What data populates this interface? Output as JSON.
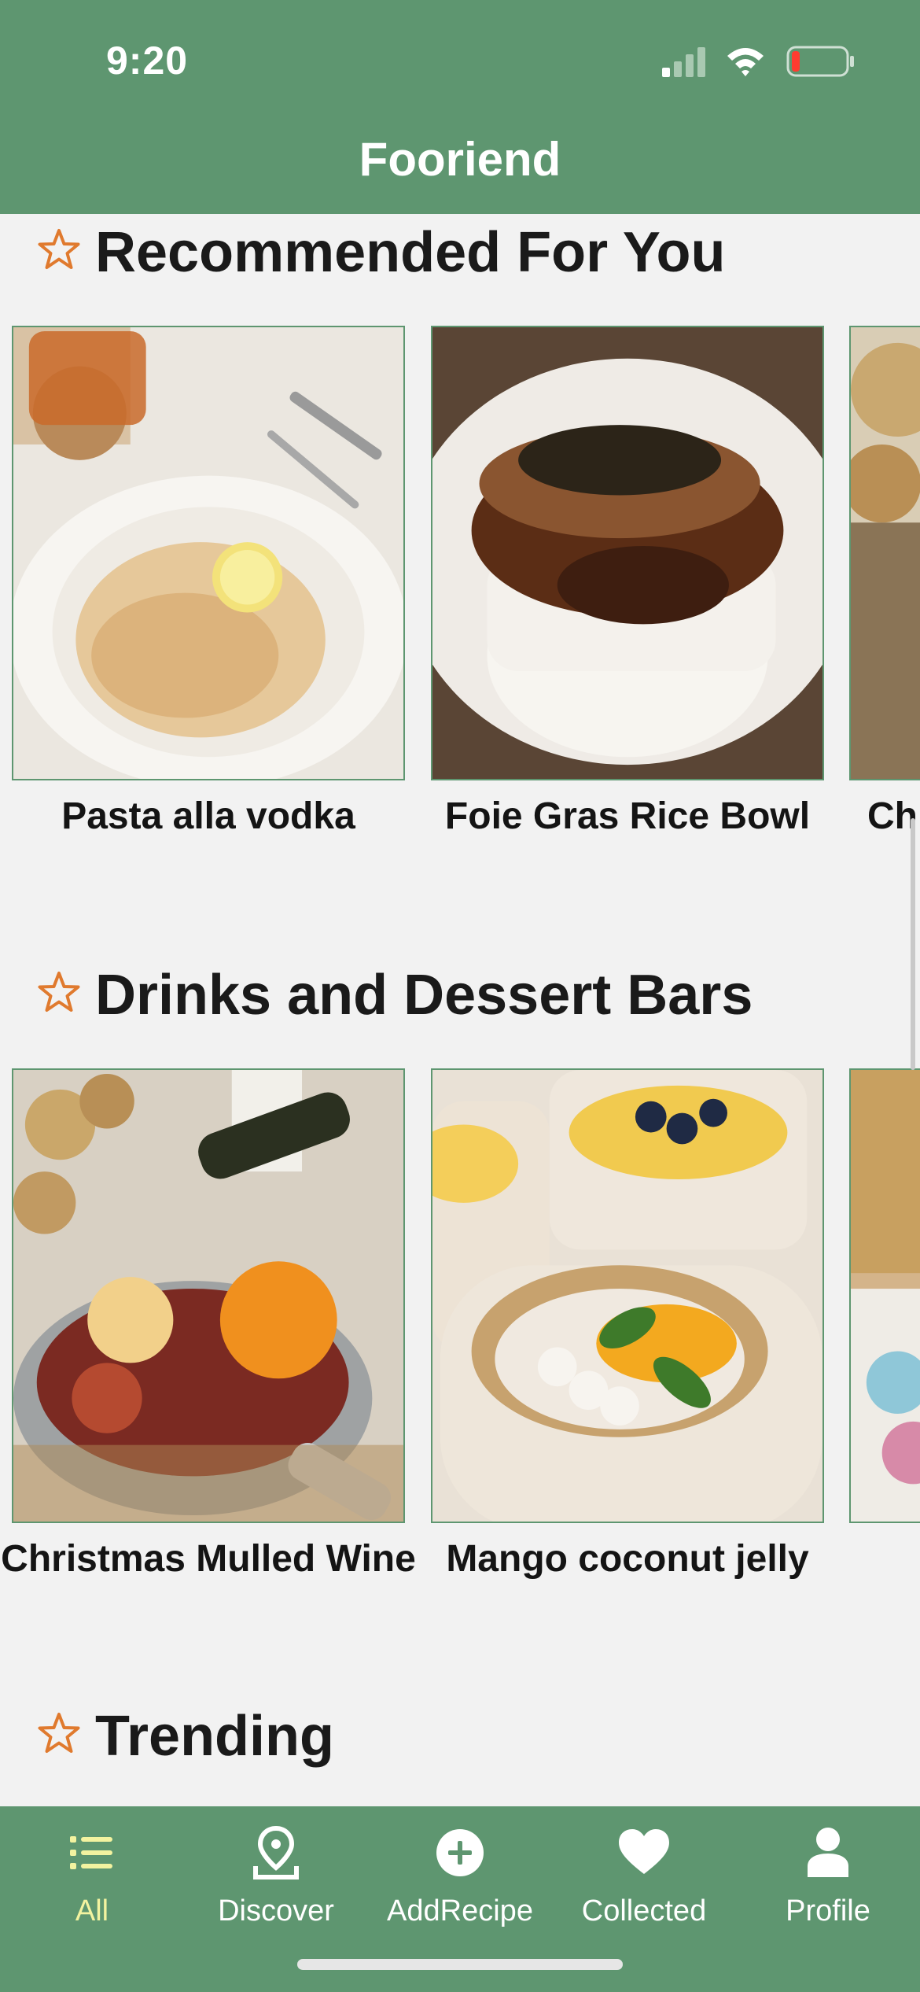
{
  "status_bar": {
    "time": "9:20",
    "icons": [
      "cellular-signal-icon",
      "wifi-icon",
      "battery-low-icon"
    ]
  },
  "header": {
    "title": "Fooriend"
  },
  "sections": [
    {
      "title": "Recommended For You",
      "icon": "star-outline-icon",
      "cards": [
        {
          "label": "Pasta alla vodka"
        },
        {
          "label": "Foie Gras Rice Bowl"
        },
        {
          "label": "Ch"
        }
      ]
    },
    {
      "title": "Drinks and Dessert Bars",
      "icon": "star-outline-icon",
      "cards": [
        {
          "label": "Christmas Mulled Wine"
        },
        {
          "label": "Mango coconut jelly"
        },
        {
          "label": ""
        }
      ]
    },
    {
      "title": "Trending",
      "icon": "star-outline-icon",
      "cards": []
    }
  ],
  "tabbar": {
    "items": [
      {
        "label": "All",
        "icon": "list-icon",
        "active": true
      },
      {
        "label": "Discover",
        "icon": "map-pin-icon",
        "active": false
      },
      {
        "label": "AddRecipe",
        "icon": "plus-circle-icon",
        "active": false
      },
      {
        "label": "Collected",
        "icon": "heart-icon",
        "active": false
      },
      {
        "label": "Profile",
        "icon": "person-icon",
        "active": false
      }
    ]
  },
  "colors": {
    "brand_green": "#5e9670",
    "star_orange": "#e07a2e",
    "active_tab": "#f3f3a0",
    "background": "#f2f2f2"
  }
}
